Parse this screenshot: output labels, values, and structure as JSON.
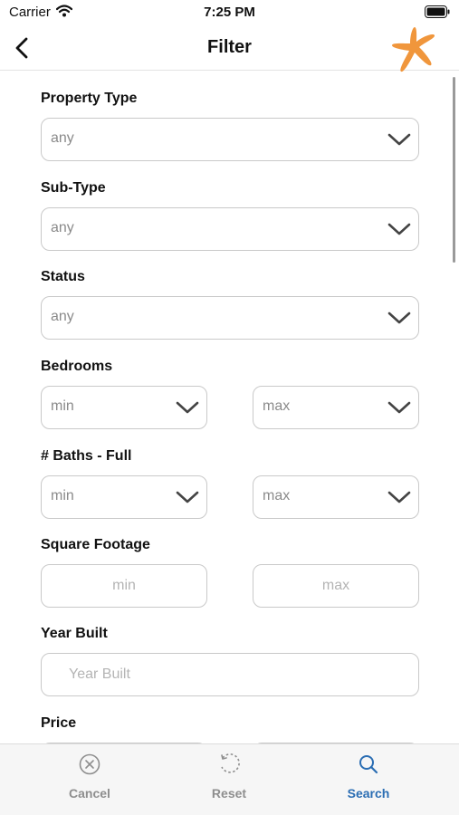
{
  "status_bar": {
    "carrier": "Carrier",
    "time": "7:25 PM"
  },
  "nav": {
    "title": "Filter"
  },
  "form": {
    "property_type": {
      "label": "Property Type",
      "value": "any"
    },
    "sub_type": {
      "label": "Sub-Type",
      "value": "any"
    },
    "status": {
      "label": "Status",
      "value": "any"
    },
    "bedrooms": {
      "label": "Bedrooms",
      "min": "min",
      "max": "max"
    },
    "baths_full": {
      "label": "# Baths - Full",
      "min": "min",
      "max": "max"
    },
    "square_footage": {
      "label": "Square Footage",
      "min_placeholder": "min",
      "max_placeholder": "max"
    },
    "year_built": {
      "label": "Year Built",
      "placeholder": "Year Built"
    },
    "price": {
      "label": "Price"
    }
  },
  "tab_bar": {
    "cancel": {
      "label": "Cancel",
      "icon": "x-circle-icon"
    },
    "reset": {
      "label": "Reset",
      "icon": "reset-icon"
    },
    "search": {
      "label": "Search",
      "icon": "search-icon"
    }
  },
  "colors": {
    "accent": "#2a6db3",
    "logo": "#f0963c",
    "border": "#c9c9c9"
  }
}
